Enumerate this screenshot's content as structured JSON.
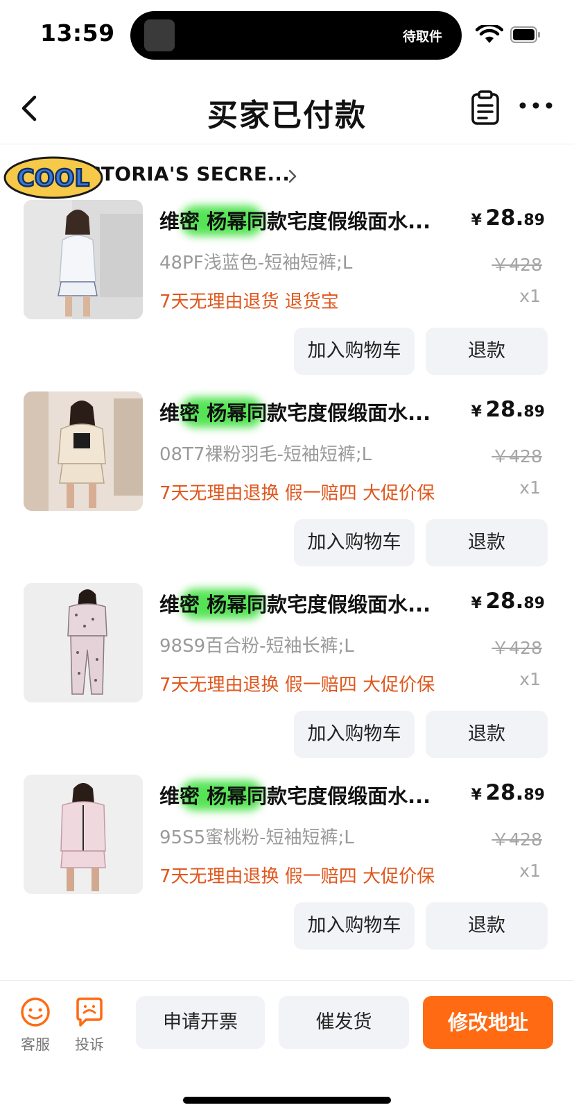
{
  "status_bar": {
    "time": "13:59",
    "island_text": "待取件",
    "icons": [
      "wifi-icon",
      "battery-icon"
    ]
  },
  "nav": {
    "title": "买家已付款",
    "icons": [
      "back-icon",
      "clipboard-icon",
      "more-icon"
    ]
  },
  "shop": {
    "logo_text": "COOL",
    "name": "CTORIA'S SECRE...",
    "chevron_icon": "chevron-right-icon"
  },
  "products": [
    {
      "title": "维密 杨幂同款宅度假缎面水...",
      "sku": "48PF浅蓝色-短袖短裤;L",
      "service": "7天无理由退货 退货宝",
      "currency": "¥",
      "price_int": "28.",
      "price_dec": "89",
      "orig_price": "￥428",
      "qty": "x1",
      "add_cart": "加入购物车",
      "refund": "退款"
    },
    {
      "title": "维密 杨幂同款宅度假缎面水...",
      "sku": "08T7裸粉羽毛-短袖短裤;L",
      "service": "7天无理由退换 假一赔四 大促价保",
      "currency": "¥",
      "price_int": "28.",
      "price_dec": "89",
      "orig_price": "￥428",
      "qty": "x1",
      "add_cart": "加入购物车",
      "refund": "退款"
    },
    {
      "title": "维密 杨幂同款宅度假缎面水...",
      "sku": "98S9百合粉-短袖长裤;L",
      "service": "7天无理由退换 假一赔四 大促价保",
      "currency": "¥",
      "price_int": "28.",
      "price_dec": "89",
      "orig_price": "￥428",
      "qty": "x1",
      "add_cart": "加入购物车",
      "refund": "退款"
    },
    {
      "title": "维密 杨幂同款宅度假缎面水...",
      "sku": "95S5蜜桃粉-短袖短裤;L",
      "service": "7天无理由退换 假一赔四 大促价保",
      "currency": "¥",
      "price_int": "28.",
      "price_dec": "89",
      "orig_price": "￥428",
      "qty": "x1",
      "add_cart": "加入购物车",
      "refund": "退款"
    }
  ],
  "bottom_bar": {
    "customer_service": "客服",
    "complaint": "投诉",
    "invoice": "申请开票",
    "urge_ship": "催发货",
    "change_address": "修改地址"
  },
  "colors": {
    "accent": "#ff6a13",
    "service_text": "#e0571d",
    "button_bg": "#f1f3f6"
  }
}
